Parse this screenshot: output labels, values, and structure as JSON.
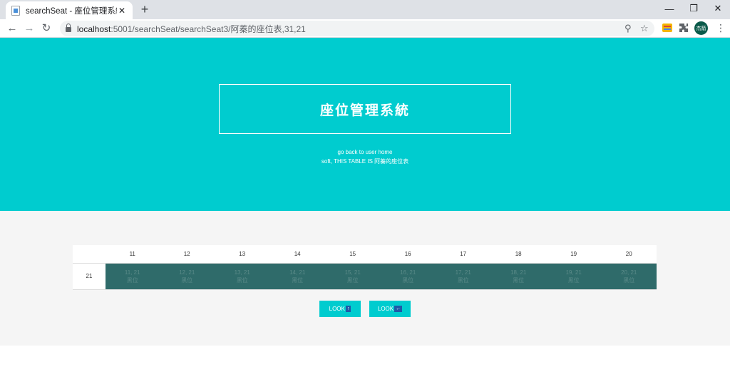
{
  "browser": {
    "tab_title": "searchSeat - 座位管理系統",
    "tab_close": "✕",
    "new_tab": "+",
    "window_controls": [
      "—",
      "❐",
      "✕"
    ],
    "back": "←",
    "forward": "→",
    "reload": "↻",
    "url_host": "localhost",
    "url_rest": ":5001/searchSeat/searchSeat3/阿蓁的座位表,31,21",
    "zoom_icon": "⚲",
    "star_icon": "☆",
    "avatar_text": "杰箭",
    "menu": "⋮"
  },
  "hero": {
    "title": "座位管理系統",
    "link": "go back to user home",
    "subtitle": "soft, THIS TABLE IS 阿蓁的座位表"
  },
  "table": {
    "columns": [
      "11",
      "12",
      "13",
      "14",
      "15",
      "16",
      "17",
      "18",
      "19",
      "20"
    ],
    "row_label": "21",
    "cells": [
      {
        "coord": "11, 21",
        "status": "黑位"
      },
      {
        "coord": "12, 21",
        "status": "黑位"
      },
      {
        "coord": "13, 21",
        "status": "黑位"
      },
      {
        "coord": "14, 21",
        "status": "黑位"
      },
      {
        "coord": "15, 21",
        "status": "黑位"
      },
      {
        "coord": "16, 21",
        "status": "黑位"
      },
      {
        "coord": "17, 21",
        "status": "黑位"
      },
      {
        "coord": "18, 21",
        "status": "黑位"
      },
      {
        "coord": "19, 21",
        "status": "黑位"
      },
      {
        "coord": "20, 21",
        "status": "黑位"
      }
    ]
  },
  "buttons": {
    "look_up_label": "LOOK",
    "look_up_arrow": "↑",
    "look_left_label": "LOOK",
    "look_left_arrow": "←"
  },
  "colors": {
    "hero": "#00cccf",
    "seat": "#2f6b6a",
    "button": "#00cccf"
  }
}
